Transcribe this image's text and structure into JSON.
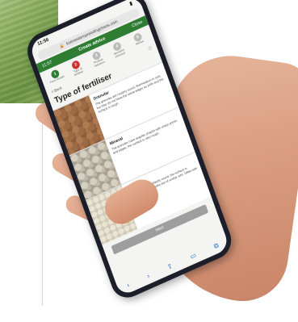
{
  "status": {
    "time": "11:56"
  },
  "browser": {
    "url": "ksenastanspreadingcharts.com"
  },
  "app": {
    "title": "Create advice",
    "status_time": "11:57",
    "menu_label": "Close"
  },
  "steps": [
    {
      "num": "1",
      "label": "Farm details",
      "state": "done"
    },
    {
      "num": "2",
      "label": "Type of fertiliser",
      "state": "active"
    },
    {
      "num": "3",
      "label": "Product selection",
      "state": "todo"
    },
    {
      "num": "4",
      "label": "Spreader selection",
      "state": "todo"
    },
    {
      "num": "5",
      "label": "Advice",
      "state": "todo"
    }
  ],
  "nav": {
    "back": "< Back"
  },
  "page": {
    "heading": "Type of fertiliser"
  },
  "options": [
    {
      "title": "Granular",
      "desc": "The granules are roughly round, fine/medium in size, but they do not have the same edges as prills and the surface is rough."
    },
    {
      "title": "Mineral",
      "desc": "The granules have angular shapes with sharp points and edges; the surface is very rough."
    },
    {
      "title": "Prills",
      "desc": "The granules are perfectly round; the surface is smooth and the granules are of similar size. Often with a hole in the surface."
    }
  ],
  "buttons": {
    "next": "Next"
  },
  "bottom_icons": [
    "back-icon",
    "forward-icon",
    "share-icon",
    "book-icon",
    "tabs-icon"
  ]
}
